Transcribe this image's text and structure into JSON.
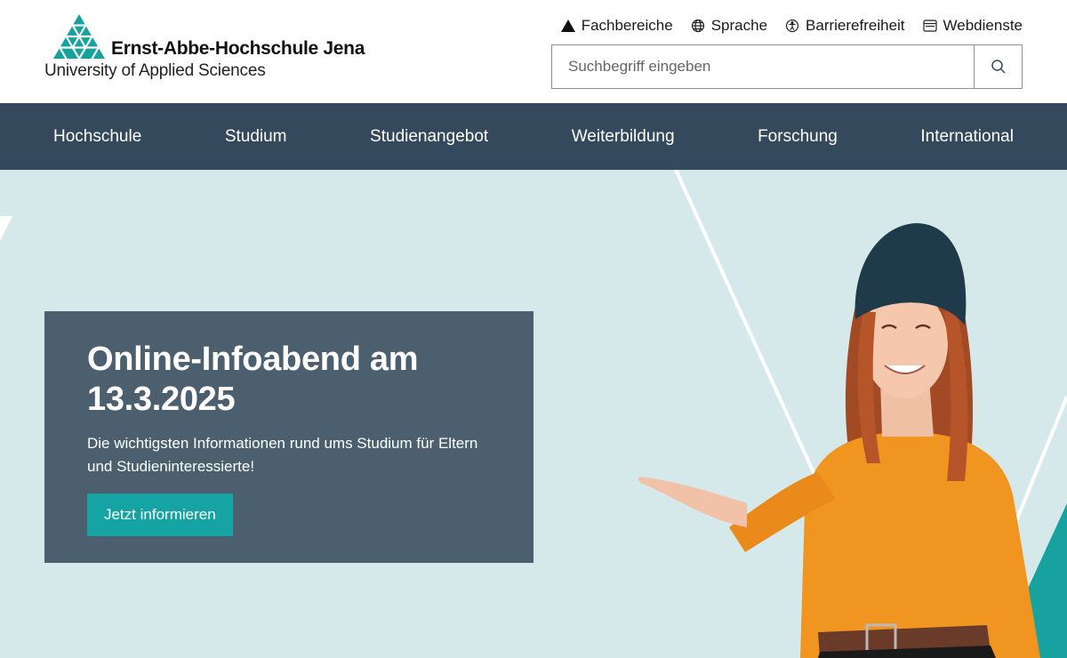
{
  "header": {
    "logo_name": "Ernst-Abbe-Hochschule Jena",
    "logo_subtitle": "University of Applied Sciences",
    "service_nav": [
      {
        "label": "Fachbereiche",
        "icon": "triangle-icon"
      },
      {
        "label": "Sprache",
        "icon": "globe-icon"
      },
      {
        "label": "Barrierefreiheit",
        "icon": "accessibility-icon"
      },
      {
        "label": "Webdienste",
        "icon": "browser-window-icon"
      }
    ],
    "search": {
      "placeholder": "Suchbegriff eingeben",
      "value": "",
      "button_icon": "search-icon"
    }
  },
  "main_nav": {
    "items": [
      "Hochschule",
      "Studium",
      "Studienangebot",
      "Weiterbildung",
      "Forschung",
      "International"
    ]
  },
  "hero": {
    "title": "Online-Infoabend am 13.3.2025",
    "text": "Die wichtigsten Informationen rund ums Studium für Eltern und Studieninteressierte!",
    "button_label": "Jetzt informieren"
  },
  "colors": {
    "nav_bg": "#34495c",
    "hero_bg": "#d6e9ea",
    "card_bg": "#4b5f6e",
    "accent": "#16a3a3"
  }
}
